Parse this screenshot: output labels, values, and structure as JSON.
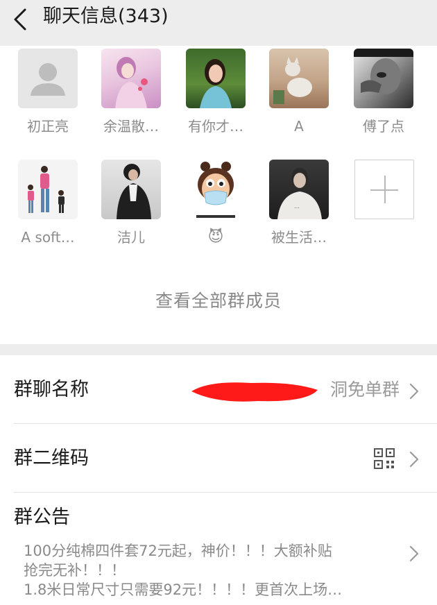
{
  "header": {
    "title": "聊天信息(343)"
  },
  "members": [
    {
      "name": "初正亮"
    },
    {
      "name": "余温散…"
    },
    {
      "name": "有你才…"
    },
    {
      "name": "A"
    },
    {
      "name": "傅了点"
    },
    {
      "name": "A soft…"
    },
    {
      "name": "洁儿"
    },
    {
      "name": "😈"
    },
    {
      "name": "被生活…"
    }
  ],
  "view_all_label": "查看全部群成员",
  "settings": {
    "group_name_label": "群聊名称",
    "group_name_value": "洞免单群",
    "qr_label": "群二维码",
    "notice_label": "群公告",
    "notice_lines": [
      "100分纯棉四件套72元起，神价！！！大额补贴",
      "抢完无补！！！",
      "1.8米日常尺寸只需要92元！！！！更首次上场…"
    ]
  },
  "colors": {
    "header_bg": "#ededed",
    "redaction": "#ff1a1a"
  }
}
